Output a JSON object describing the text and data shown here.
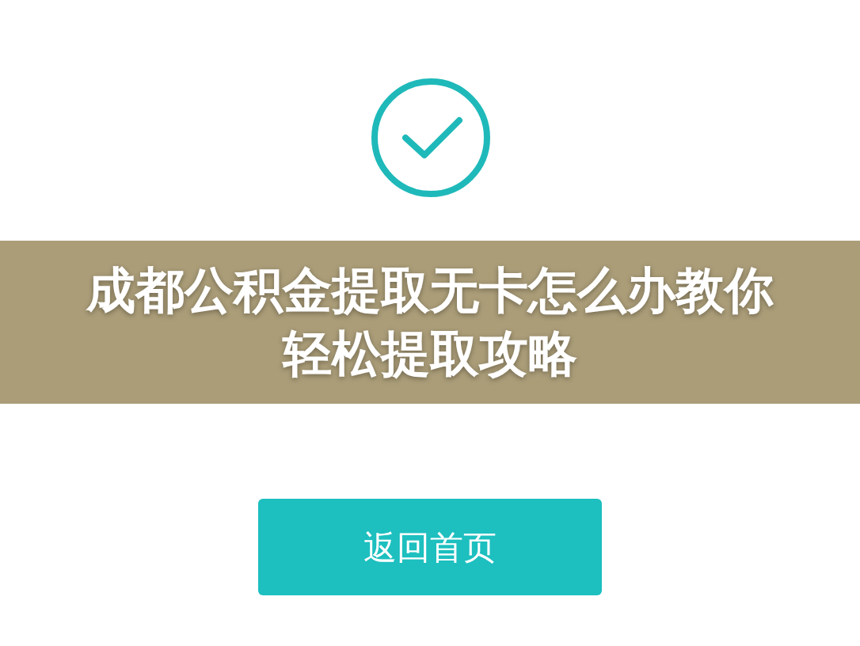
{
  "banner": {
    "title": "成都公积金提取无卡怎么办教你轻松提取攻略"
  },
  "button": {
    "label": "返回首页"
  }
}
